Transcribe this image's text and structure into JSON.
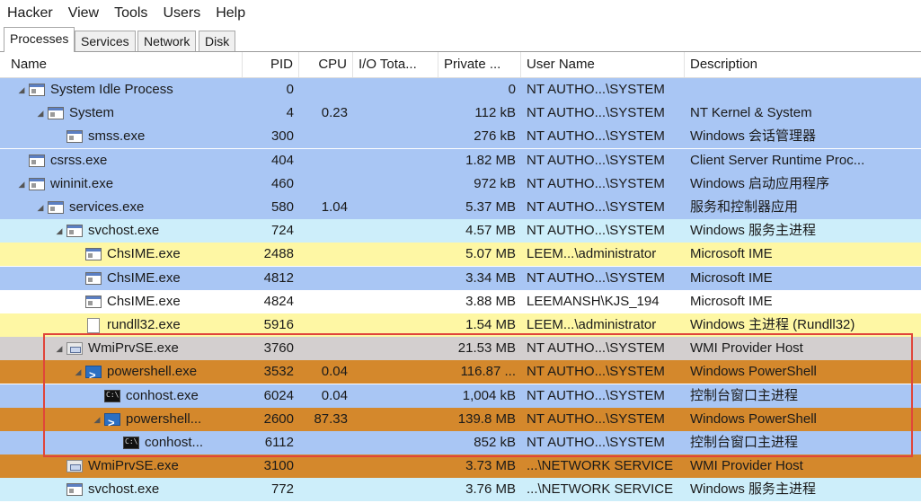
{
  "menu": [
    "Hacker",
    "View",
    "Tools",
    "Users",
    "Help"
  ],
  "tabs": [
    "Processes",
    "Services",
    "Network",
    "Disk"
  ],
  "columns": {
    "name": "Name",
    "pid": "PID",
    "cpu": "CPU",
    "io": "I/O Tota...",
    "private": "Private ...",
    "user": "User Name",
    "description": "Description"
  },
  "colors": {
    "system_blue": "#a9c6f4",
    "service_teal": "#cdeefa",
    "own_process_yellow": "#fef7a4",
    "suspended_gray": "#d3cfcf",
    "dotnet_orange": "#d4882c",
    "highlight_border": "#e0453a"
  },
  "processes": [
    {
      "name": "System Idle Process",
      "pid": "0",
      "cpu": "",
      "io": "",
      "private": "0",
      "user": "NT AUTHO...\\SYSTEM",
      "description": "",
      "icon": "window-icon",
      "expand": "collapse",
      "bg": "#a9c6f4"
    },
    {
      "name": "System",
      "pid": "4",
      "cpu": "0.23",
      "io": "",
      "private": "112 kB",
      "user": "NT AUTHO...\\SYSTEM",
      "description": "NT Kernel & System",
      "icon": "window-icon",
      "expand": "collapse",
      "bg": "#a9c6f4"
    },
    {
      "name": "smss.exe",
      "pid": "300",
      "cpu": "",
      "io": "",
      "private": "276 kB",
      "user": "NT AUTHO...\\SYSTEM",
      "description": "Windows 会话管理器",
      "icon": "window-icon",
      "expand": "",
      "bg": "#a9c6f4"
    },
    {
      "name": "csrss.exe",
      "pid": "404",
      "cpu": "",
      "io": "",
      "private": "1.82 MB",
      "user": "NT AUTHO...\\SYSTEM",
      "description": "Client Server Runtime Proc...",
      "icon": "window-icon",
      "expand": "",
      "bg": "#a9c6f4"
    },
    {
      "name": "wininit.exe",
      "pid": "460",
      "cpu": "",
      "io": "",
      "private": "972 kB",
      "user": "NT AUTHO...\\SYSTEM",
      "description": "Windows 启动应用程序",
      "icon": "window-icon",
      "expand": "collapse",
      "bg": "#a9c6f4"
    },
    {
      "name": "services.exe",
      "pid": "580",
      "cpu": "1.04",
      "io": "",
      "private": "5.37 MB",
      "user": "NT AUTHO...\\SYSTEM",
      "description": "服务和控制器应用",
      "icon": "window-icon",
      "expand": "collapse",
      "bg": "#a9c6f4"
    },
    {
      "name": "svchost.exe",
      "pid": "724",
      "cpu": "",
      "io": "",
      "private": "4.57 MB",
      "user": "NT AUTHO...\\SYSTEM",
      "description": "Windows 服务主进程",
      "icon": "window-icon",
      "expand": "collapse",
      "bg": "#cdeefa"
    },
    {
      "name": "ChsIME.exe",
      "pid": "2488",
      "cpu": "",
      "io": "",
      "private": "5.07 MB",
      "user": "LEEM...\\administrator",
      "description": "Microsoft IME",
      "icon": "window-icon",
      "expand": "",
      "bg": "#fef7a4"
    },
    {
      "name": "ChsIME.exe",
      "pid": "4812",
      "cpu": "",
      "io": "",
      "private": "3.34 MB",
      "user": "NT AUTHO...\\SYSTEM",
      "description": "Microsoft IME",
      "icon": "window-icon",
      "expand": "",
      "bg": "#a9c6f4"
    },
    {
      "name": "ChsIME.exe",
      "pid": "4824",
      "cpu": "",
      "io": "",
      "private": "3.88 MB",
      "user": "LEEMANSH\\KJS_194",
      "description": "Microsoft IME",
      "icon": "window-icon",
      "expand": "",
      "bg": "#ffffff"
    },
    {
      "name": "rundll32.exe",
      "pid": "5916",
      "cpu": "",
      "io": "",
      "private": "1.54 MB",
      "user": "LEEM...\\administrator",
      "description": "Windows 主进程 (Rundll32)",
      "icon": "document-icon",
      "expand": "",
      "bg": "#fef7a4"
    },
    {
      "name": "WmiPrvSE.exe",
      "pid": "3760",
      "cpu": "",
      "io": "",
      "private": "21.53 MB",
      "user": "NT AUTHO...\\SYSTEM",
      "description": "WMI Provider Host",
      "icon": "wmi-icon",
      "expand": "collapse",
      "bg": "#d3cfcf"
    },
    {
      "name": "powershell.exe",
      "pid": "3532",
      "cpu": "0.04",
      "io": "",
      "private": "116.87 ...",
      "user": "NT AUTHO...\\SYSTEM",
      "description": "Windows PowerShell",
      "icon": "powershell-icon",
      "expand": "collapse",
      "bg": "#d4882c"
    },
    {
      "name": "conhost.exe",
      "pid": "6024",
      "cpu": "0.04",
      "io": "",
      "private": "1,004 kB",
      "user": "NT AUTHO...\\SYSTEM",
      "description": "控制台窗口主进程",
      "icon": "console-icon",
      "expand": "",
      "bg": "#a9c6f4"
    },
    {
      "name": "powershell...",
      "pid": "2600",
      "cpu": "87.33",
      "io": "",
      "private": "139.8 MB",
      "user": "NT AUTHO...\\SYSTEM",
      "description": "Windows PowerShell",
      "icon": "powershell-icon",
      "expand": "collapse",
      "bg": "#d4882c"
    },
    {
      "name": "conhost...",
      "pid": "6112",
      "cpu": "",
      "io": "",
      "private": "852 kB",
      "user": "NT AUTHO...\\SYSTEM",
      "description": "控制台窗口主进程",
      "icon": "console-icon",
      "expand": "",
      "bg": "#a9c6f4"
    },
    {
      "name": "WmiPrvSE.exe",
      "pid": "3100",
      "cpu": "",
      "io": "",
      "private": "3.73 MB",
      "user": "...\\NETWORK SERVICE",
      "description": "WMI Provider Host",
      "icon": "wmi-icon",
      "expand": "",
      "bg": "#d4882c"
    },
    {
      "name": "svchost.exe",
      "pid": "772",
      "cpu": "",
      "io": "",
      "private": "3.76 MB",
      "user": "...\\NETWORK SERVICE",
      "description": "Windows 服务主进程",
      "icon": "window-icon",
      "expand": "",
      "bg": "#cdeefa"
    }
  ]
}
